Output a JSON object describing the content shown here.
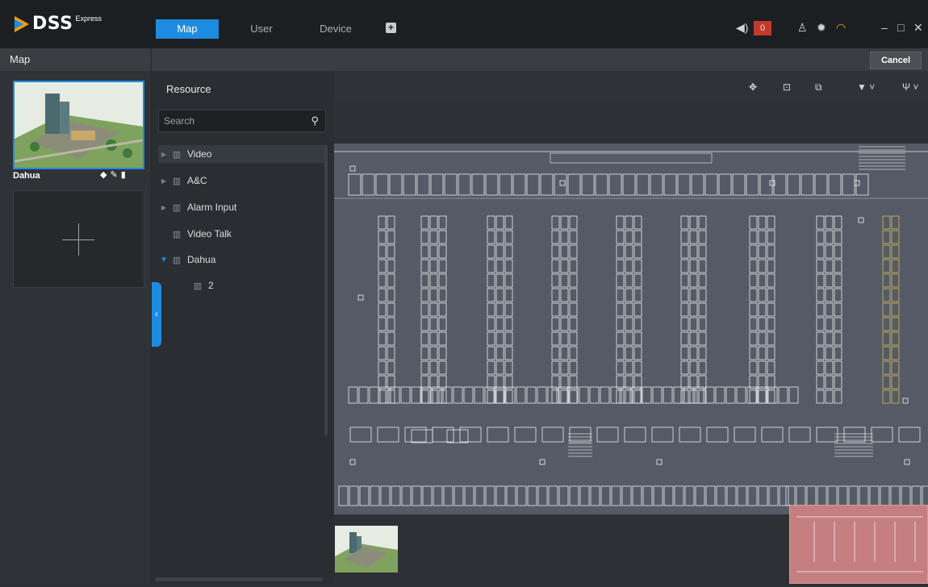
{
  "app": {
    "brand": "DSS",
    "brand_sup": "Express",
    "tabs": [
      {
        "label": "Map",
        "active": true
      },
      {
        "label": "User",
        "active": false
      },
      {
        "label": "Device",
        "active": false
      }
    ],
    "alarm_count": "0",
    "accent_color": "#1d8ce0"
  },
  "subbar": {
    "title": "Map",
    "cancel_label": "Cancel"
  },
  "maps": [
    {
      "name": "Dahua",
      "selected": true
    }
  ],
  "resource": {
    "title": "Resource",
    "search_placeholder": "Search",
    "tree": [
      {
        "label": "Video",
        "expandable": true
      },
      {
        "label": "A&C",
        "expandable": true
      },
      {
        "label": "Alarm Input",
        "expandable": true
      },
      {
        "label": "Video Talk",
        "expandable": false
      },
      {
        "label": "Dahua",
        "expandable": true,
        "expanded": true
      },
      {
        "label": "2",
        "expandable": false,
        "child": true
      }
    ]
  },
  "toolbar_icons": [
    "move-icon",
    "rect-select-icon",
    "crop-icon",
    "filter-icon",
    "antenna-icon"
  ]
}
